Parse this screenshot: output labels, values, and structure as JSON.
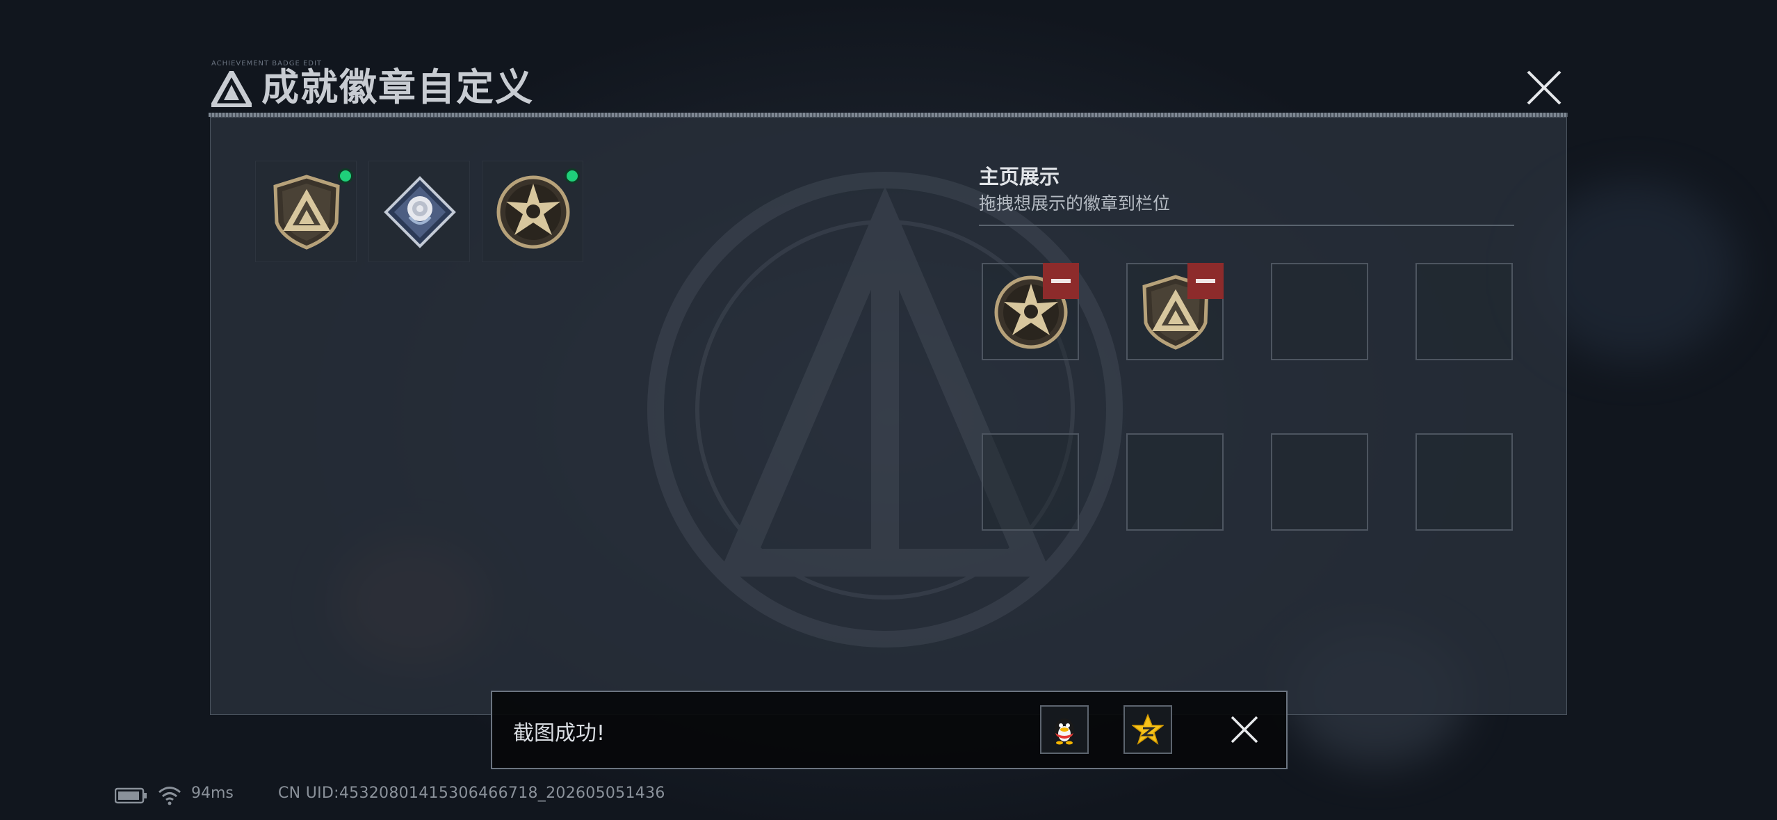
{
  "dialog": {
    "title": "成就徽章自定义",
    "header_microtext": "ACHIEVEMENT BADGE EDIT"
  },
  "inventory": {
    "badges": [
      {
        "icon": "triangle-shield-badge-icon",
        "equipped": true
      },
      {
        "icon": "rose-diamond-badge-icon",
        "equipped": false
      },
      {
        "icon": "skull-star-badge-icon",
        "equipped": true
      }
    ]
  },
  "showcase": {
    "title": "主页展示",
    "hint": "拖拽想展示的徽章到栏位",
    "slots": [
      {
        "badge": "skull-star-badge-icon",
        "removable": true
      },
      {
        "badge": "triangle-shield-badge-icon",
        "removable": true
      },
      {
        "badge": null
      },
      {
        "badge": null
      },
      {
        "badge": null
      },
      {
        "badge": null
      },
      {
        "badge": null
      },
      {
        "badge": null
      }
    ]
  },
  "toast": {
    "message": "截图成功!",
    "share_targets": [
      "qq-penguin-icon",
      "qzone-star-icon"
    ]
  },
  "status_bar": {
    "ping": "94ms",
    "uid": "CN UID:4532080141530646671​8_202605051436"
  },
  "colors": {
    "equipped_indicator": "#1fd07a",
    "remove_button": "#8d2b2b",
    "badge_gold": "#b7a27a"
  }
}
